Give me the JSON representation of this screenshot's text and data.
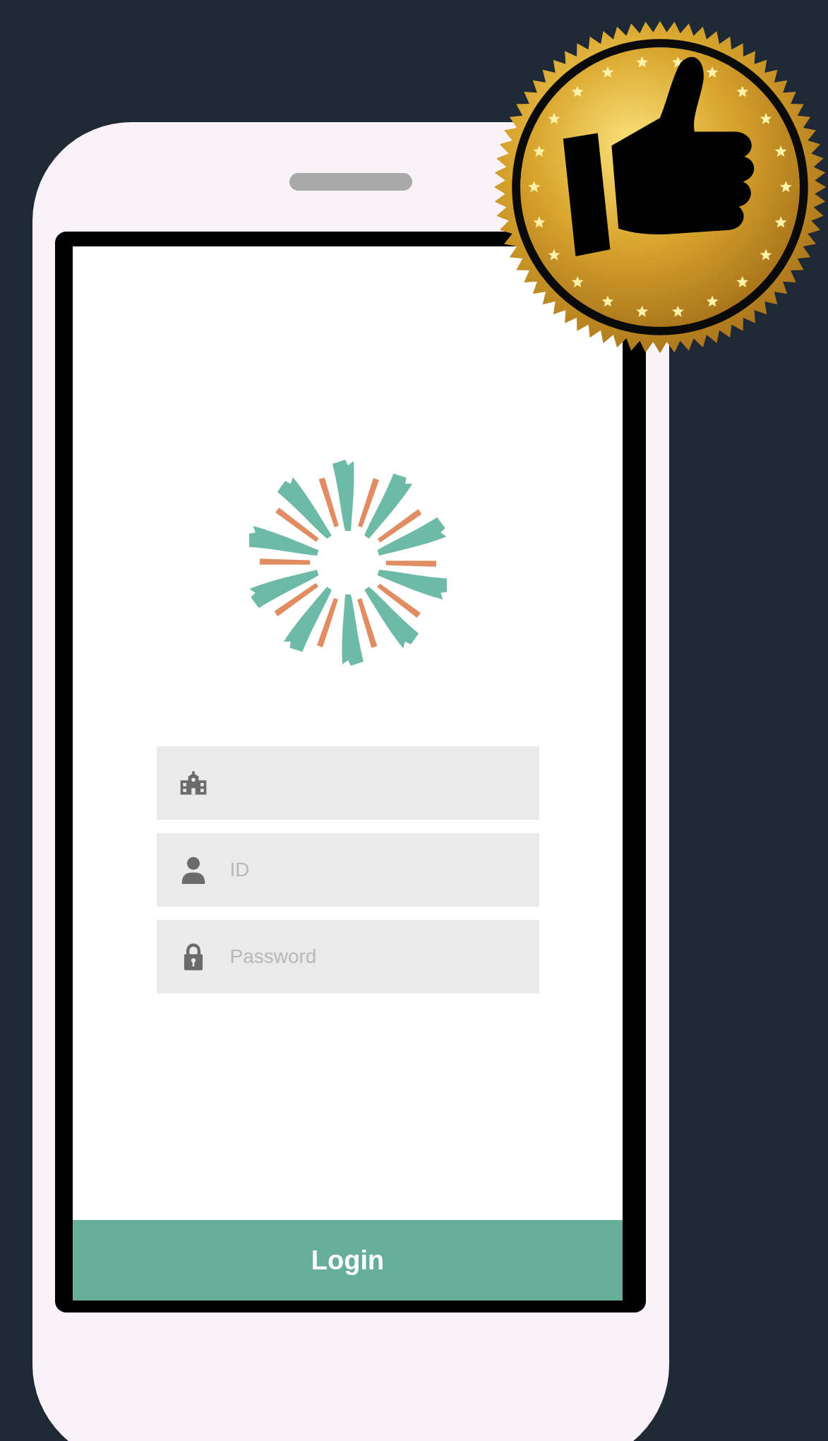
{
  "login_form": {
    "fields": [
      {
        "kind": "school"
      },
      {
        "kind": "user",
        "placeholder": "ID"
      },
      {
        "kind": "lock",
        "placeholder": "Password"
      }
    ]
  },
  "login_button": {
    "label": "Login"
  }
}
